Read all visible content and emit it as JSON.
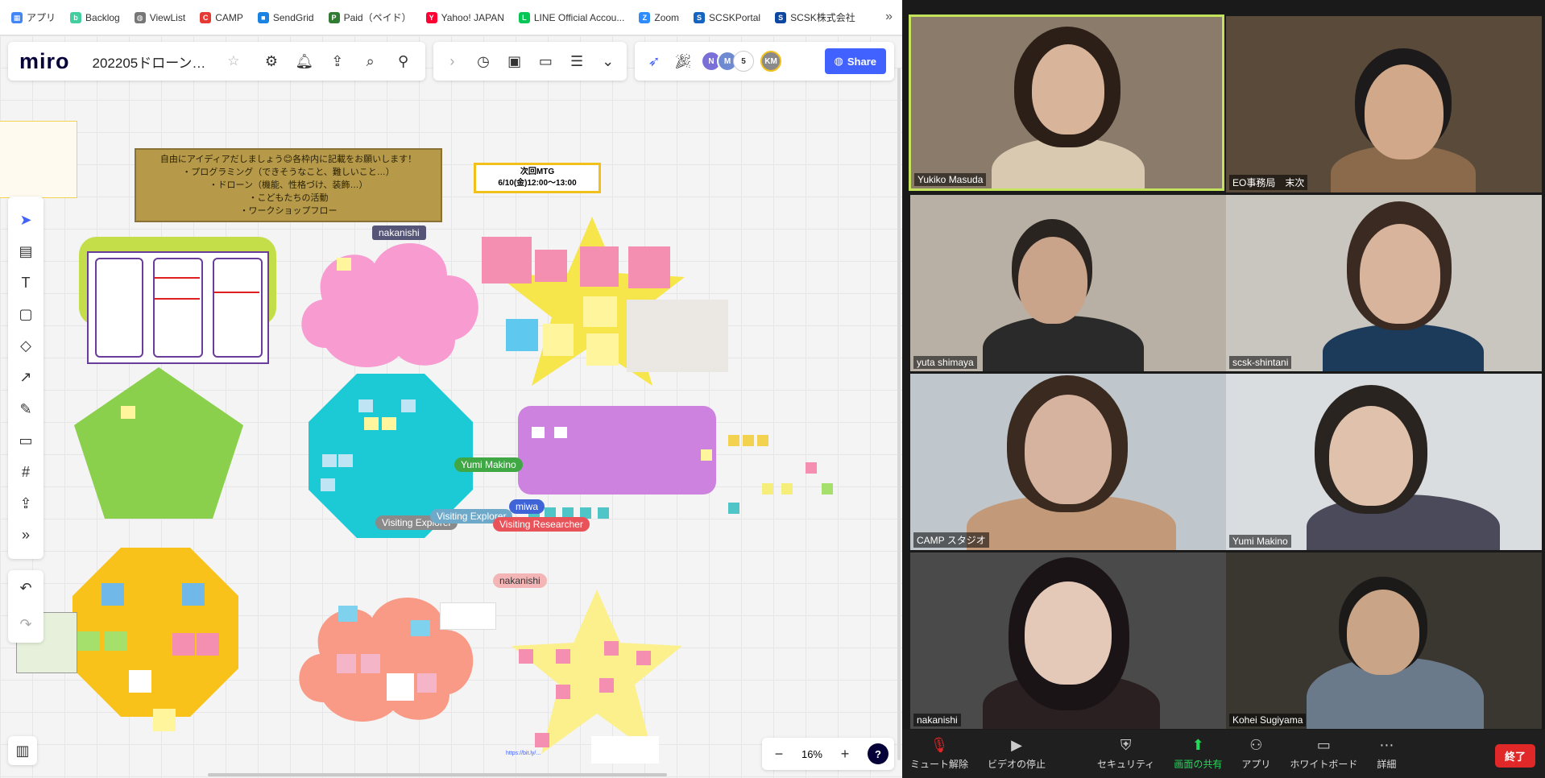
{
  "bookmarks": [
    {
      "label": "アプリ",
      "icon": "grid-icon",
      "color": "#4285f4"
    },
    {
      "label": "Backlog",
      "icon": "backlog-icon",
      "color": "#42ce9f"
    },
    {
      "label": "ViewList",
      "icon": "globe-icon",
      "color": "#777777"
    },
    {
      "label": "CAMP",
      "icon": "camp-icon",
      "color": "#e53935"
    },
    {
      "label": "SendGrid",
      "icon": "sendgrid-icon",
      "color": "#1a82e2"
    },
    {
      "label": "Paid（ペイド）",
      "icon": "paid-icon",
      "color": "#2e7d32"
    },
    {
      "label": "Yahoo! JAPAN",
      "icon": "yahoo-icon",
      "color": "#ff0033"
    },
    {
      "label": "LINE Official Accou...",
      "icon": "line-icon",
      "color": "#06c755"
    },
    {
      "label": "Zoom",
      "icon": "zoom-icon",
      "color": "#2d8cff"
    },
    {
      "label": "SCSKPortal",
      "icon": "scsk-icon",
      "color": "#1565c0"
    },
    {
      "label": "SCSK株式会社",
      "icon": "scsk2-icon",
      "color": "#0d47a1"
    }
  ],
  "miro": {
    "logo": "miro",
    "board_name": "202205ドローンワ...",
    "online_count": "5",
    "avatars": [
      {
        "initial": "N",
        "color": "#7a6fd6"
      },
      {
        "initial": "M",
        "color": "#6e8bd1"
      },
      {
        "initial": "KM",
        "color": "#8a8a8a"
      }
    ],
    "share_label": "Share",
    "zoom_level": "16%",
    "help_label": "?",
    "url_text": "https://bit.ly/...",
    "canvas": {
      "main_text_lines": [
        "自由にアイディアだしましょう😊各枠内に記載をお願いします！",
        "・プログラミング（できそうなこと、難しいこと…）",
        "・ドローン（機能、性格づけ、装飾…）",
        "・こどもたちの活動",
        "・ワークショップフロー"
      ],
      "next_mtg_title": "次回MTG",
      "next_mtg_time": "6/10(金)12:00〜13:00",
      "cursors": [
        {
          "label": "nakanishi",
          "color": "#555577"
        },
        {
          "label": "Yumi Makino",
          "color": "#3fa845"
        },
        {
          "label": "miwa",
          "color": "#3f64d8"
        },
        {
          "label": "Visiting Explorer",
          "color": "#8a8a8a"
        },
        {
          "label": "Visiting Explorer",
          "color": "#6fa9c9"
        },
        {
          "label": "Visiting Researcher",
          "color": "#e8535a"
        },
        {
          "label": "nakanishi",
          "color": "#f3b5b5"
        }
      ]
    }
  },
  "zoom": {
    "participants": [
      {
        "name": "Yukiko Masuda",
        "active": true,
        "bg": "#8a7b6a",
        "skin": "#d8b59a",
        "hair": "#2b1f18",
        "shirt": "#d9c9b0"
      },
      {
        "name": "EO事務局　末次",
        "active": false,
        "bg": "#5a4a3a",
        "skin": "#d1a98a",
        "hair": "#1c1a1a",
        "shirt": "#8a6a4a"
      },
      {
        "name": "yuta shimaya",
        "active": false,
        "bg": "#b8b0a4",
        "skin": "#caa48a",
        "hair": "#2a2420",
        "shirt": "#2a2a2a"
      },
      {
        "name": "scsk-shintani",
        "active": false,
        "bg": "#c9c6c0",
        "skin": "#d8b49c",
        "hair": "#3a2a22",
        "shirt": "#1c3a5a"
      },
      {
        "name": "CAMP スタジオ",
        "active": false,
        "bg": "#bfc7cc",
        "skin": "#d6b39e",
        "hair": "#3a2a20",
        "shirt": "#c29a7a"
      },
      {
        "name": "Yumi Makino",
        "active": false,
        "bg": "#d9dde0",
        "skin": "#e0c2ac",
        "hair": "#2a2420",
        "shirt": "#4a4a5a"
      },
      {
        "name": "nakanishi",
        "active": false,
        "bg": "#4a4a4a",
        "skin": "#e4c8b8",
        "hair": "#1a1416",
        "shirt": "#2a2022"
      },
      {
        "name": "Kohei Sugiyama",
        "active": false,
        "bg": "#3a3630",
        "skin": "#c9a486",
        "hair": "#1c1a18",
        "shirt": "#6a7a8a"
      }
    ],
    "toolbar": [
      {
        "label": "ミュート解除",
        "icon": "mic-muted-icon"
      },
      {
        "label": "ビデオの停止",
        "icon": "video-camera-icon"
      },
      {
        "label": "セキュリティ",
        "icon": "shield-icon"
      },
      {
        "label": "画面の共有",
        "icon": "share-screen-icon"
      },
      {
        "label": "アプリ",
        "icon": "apps-icon"
      },
      {
        "label": "ホワイトボード",
        "icon": "whiteboard-icon"
      },
      {
        "label": "詳細",
        "icon": "more-icon"
      }
    ],
    "end_label": "終了",
    "accent_active": "#c3e35c",
    "accent_share": "#23d959"
  }
}
